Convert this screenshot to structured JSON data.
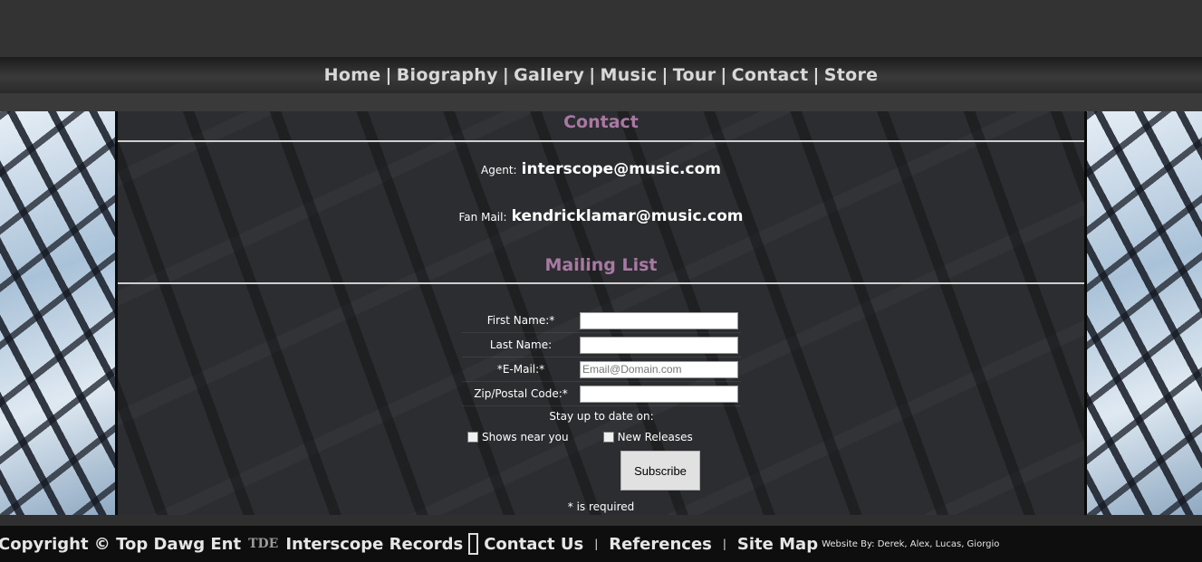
{
  "nav": {
    "items": [
      "Home",
      "Biography",
      "Gallery",
      "Music",
      "Tour",
      "Contact",
      "Store"
    ],
    "separator": "|"
  },
  "contact": {
    "title": "Contact",
    "agent_label": "Agent:",
    "agent_email": "interscope@music.com",
    "fanmail_label": "Fan Mail:",
    "fanmail_email": "kendricklamar@music.com"
  },
  "mailing_list": {
    "title": "Mailing List",
    "first_name_label": "First Name:*",
    "first_name_value": "",
    "last_name_label": "Last Name:",
    "last_name_value": "",
    "email_label": "*E-Mail:*",
    "email_placeholder": "Email@Domain.com",
    "zip_label": "Zip/Postal Code:*",
    "zip_value": "",
    "stay_text": "Stay up to date on:",
    "option_shows": "Shows near you",
    "option_releases": "New Releases",
    "subscribe_label": "Subscribe",
    "required_note": "* is required"
  },
  "footer": {
    "copyright": "Copyright © Top Dawg Ent",
    "tde_logo": "TDE",
    "interscope": "Interscope Records",
    "contact_us": "Contact Us",
    "references": "References",
    "site_map": "Site Map",
    "credits": "Website By: Derek, Alex, Lucas, Giorgio",
    "separator": "|"
  },
  "colors": {
    "accent_title": "#a879a3",
    "nav_text": "#d8d8d8",
    "footer_bg": "#0e0e0e"
  }
}
